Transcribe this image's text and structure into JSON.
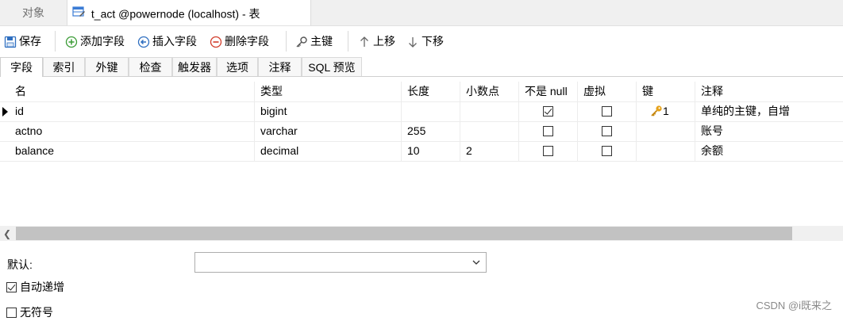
{
  "doc_tabs": {
    "objects_label": "对象",
    "active_label": "t_act @powernode (localhost) - 表"
  },
  "toolbar": {
    "save": "保存",
    "add_field": "添加字段",
    "insert_field": "插入字段",
    "delete_field": "删除字段",
    "primary_key": "主键",
    "move_up": "上移",
    "move_down": "下移"
  },
  "subtabs": [
    "字段",
    "索引",
    "外键",
    "检查",
    "触发器",
    "选项",
    "注释",
    "SQL 预览"
  ],
  "columns": [
    "名",
    "类型",
    "长度",
    "小数点",
    "不是 null",
    "虚拟",
    "键",
    "注释"
  ],
  "rows": [
    {
      "name": "id",
      "type": "bigint",
      "length": "",
      "decimals": "",
      "not_null": true,
      "virtual": false,
      "key": "1",
      "comment": "单纯的主键，自增"
    },
    {
      "name": "actno",
      "type": "varchar",
      "length": "255",
      "decimals": "",
      "not_null": false,
      "virtual": false,
      "key": "",
      "comment": "账号"
    },
    {
      "name": "balance",
      "type": "decimal",
      "length": "10",
      "decimals": "2",
      "not_null": false,
      "virtual": false,
      "key": "",
      "comment": "余额"
    }
  ],
  "bottom": {
    "default_label": "默认:",
    "default_value": "",
    "auto_increment_label": "自动递增",
    "auto_increment_checked": true,
    "unsigned_label": "无符号",
    "unsigned_checked": false
  },
  "watermark": "CSDN @i既来之",
  "colors": {
    "add_green": "#3a9b35",
    "insert_blue": "#2f6fc0",
    "delete_red": "#d23c2a",
    "key_gold": "#e6a21a",
    "scroll_thumb": "#c2c2c2"
  }
}
